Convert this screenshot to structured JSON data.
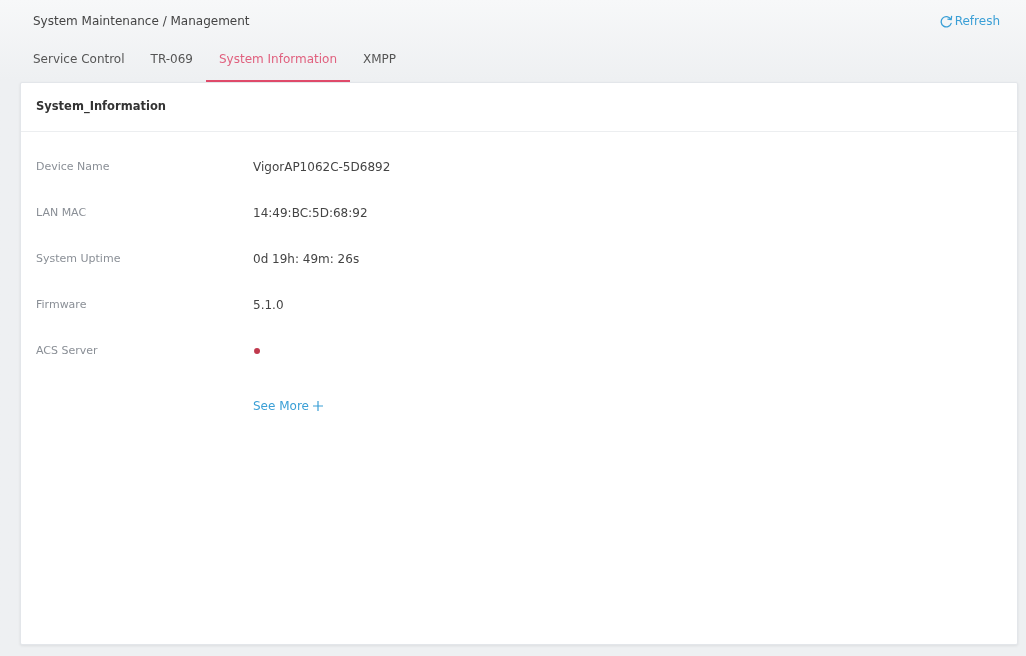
{
  "page": {
    "breadcrumb": "System Maintenance / Management",
    "refresh": "Refresh"
  },
  "tabs": [
    {
      "label": "Service Control",
      "selected": false
    },
    {
      "label": "TR-069",
      "selected": false
    },
    {
      "label": "System Information",
      "selected": true
    },
    {
      "label": "XMPP",
      "selected": false
    }
  ],
  "panel": {
    "title": "System_Information",
    "fields": [
      {
        "kind": "text",
        "label": "Device Name",
        "value": "VigorAP1062C-5D6892"
      },
      {
        "kind": "text",
        "label": "LAN MAC",
        "value": "14:49:BC:5D:68:92"
      },
      {
        "kind": "text",
        "label": "System Uptime",
        "value": "0d 19h: 49m: 26s"
      },
      {
        "kind": "text",
        "label": "Firmware",
        "value": "5.1.0"
      },
      {
        "kind": "status",
        "label": "ACS Server",
        "color": "#c0394d"
      }
    ],
    "see_more": "See More"
  }
}
